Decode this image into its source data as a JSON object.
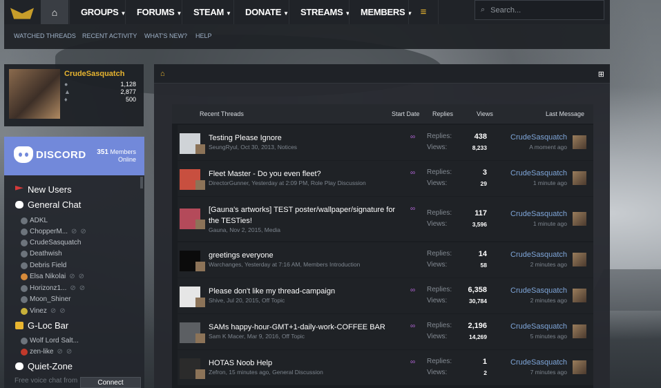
{
  "nav": {
    "items": [
      {
        "label": "GROUPS"
      },
      {
        "label": "FORUMS"
      },
      {
        "label": "STEAM"
      },
      {
        "label": "DONATE"
      },
      {
        "label": "STREAMS"
      },
      {
        "label": "MEMBERS"
      }
    ],
    "search_placeholder": "Search...",
    "sub_links": [
      "WATCHED THREADS",
      "RECENT ACTIVITY",
      "WHAT'S NEW?",
      "HELP"
    ]
  },
  "user": {
    "name": "CrudeSasquatch",
    "messages": "1,128",
    "likes": "2,877",
    "points": "500"
  },
  "discord": {
    "title": "DISCORD",
    "member_count": "351",
    "member_label": "Members",
    "online_label": "Online",
    "channels": [
      {
        "name": "New Users",
        "icon": "flag-icon"
      },
      {
        "name": "General Chat",
        "icon": "chat-icon"
      },
      {
        "name": "G-Loc Bar",
        "icon": "beer-icon"
      },
      {
        "name": "Quiet-Zone",
        "icon": "chat-icon"
      }
    ],
    "general_members": [
      "ADKL",
      "ChopperM...",
      "CrudeSasquatch",
      "Deathwish",
      "Debris Field",
      "Elsa Nikolai",
      "Horizonz1...",
      "Moon_Shiner",
      "Vinez"
    ],
    "gloc_members": [
      "Wolf Lord Salt...",
      "zen-like"
    ],
    "connect_note": "Free voice chat from",
    "connect_label": "Connect"
  },
  "recent_threads": {
    "headers": {
      "title": "Recent Threads",
      "start_date": "Start Date",
      "replies": "Replies",
      "views": "Views",
      "last_message": "Last Message"
    },
    "replies_label": "Replies:",
    "views_label": "Views:",
    "rows": [
      {
        "title": "Testing Please Ignore",
        "meta": "SeungRyul, Oct 30, 2013, Notices",
        "replies": "438",
        "views": "8,233",
        "last_user": "CrudeSasquatch",
        "last_time": "A moment ago"
      },
      {
        "title": "Fleet Master - Do you even fleet?",
        "meta": "DirectorGunner, Yesterday at 2:09 PM, Role Play Discussion",
        "replies": "3",
        "views": "29",
        "last_user": "CrudeSasquatch",
        "last_time": "1 minute ago"
      },
      {
        "title": "[Gauna's artworks] TEST poster/wallpaper/signature for the TESTies!",
        "meta": "Gauna, Nov 2, 2015, Media",
        "replies": "117",
        "views": "3,596",
        "last_user": "CrudeSasquatch",
        "last_time": "1 minute ago"
      },
      {
        "title": "greetings everyone",
        "meta": "Warchanges, Yesterday at 7:16 AM, Members Introduction",
        "replies": "14",
        "views": "58",
        "last_user": "CrudeSasquatch",
        "last_time": "2 minutes ago"
      },
      {
        "title": "Please don't like my thread-campaign",
        "meta": "Shive, Jul 20, 2015, Off Topic",
        "replies": "6,358",
        "views": "30,784",
        "last_user": "CrudeSasquatch",
        "last_time": "2 minutes ago"
      },
      {
        "title": "SAMs happy-hour-GMT+1-daily-work-COFFEE BAR",
        "meta": "Sam K Macer, Mar 9, 2016, Off Topic",
        "replies": "2,196",
        "views": "14,269",
        "last_user": "CrudeSasquatch",
        "last_time": "5 minutes ago"
      },
      {
        "title": "HOTAS Noob Help",
        "meta": "Zefron, 15 minutes ago, General Discussion",
        "replies": "1",
        "views": "2",
        "last_user": "CrudeSasquatch",
        "last_time": "7 minutes ago"
      }
    ]
  },
  "colors": {
    "accent": "#e8b530",
    "link": "#7fa6d9",
    "discord": "#7289da",
    "watch_icon": "#b265d6"
  }
}
